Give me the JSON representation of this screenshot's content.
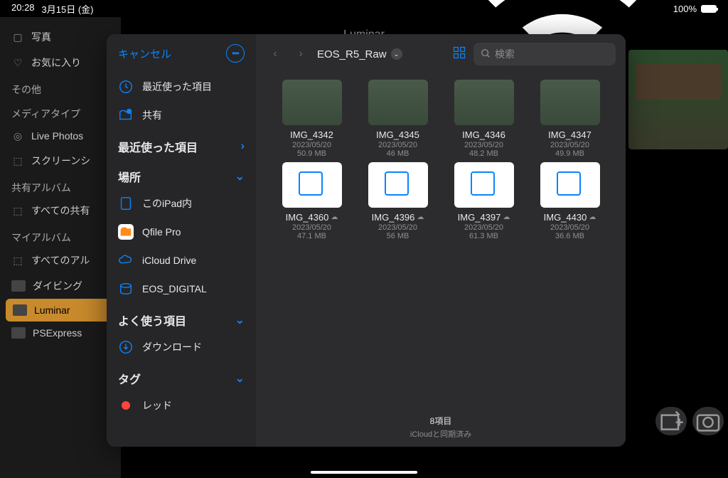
{
  "status": {
    "time": "20:28",
    "date": "3月15日 (金)",
    "battery": "100%"
  },
  "app_title": "Luminar",
  "bg_sidebar": {
    "items": [
      {
        "icon": "photo",
        "label": "写真"
      },
      {
        "icon": "heart",
        "label": "お気に入り"
      }
    ],
    "other_header": "その他",
    "media_header": "メディアタイプ",
    "media": [
      {
        "icon": "live",
        "label": "Live Photos"
      },
      {
        "icon": "screen",
        "label": "スクリーンシ"
      }
    ],
    "shared_header": "共有アルバム",
    "shared": [
      {
        "icon": "shared",
        "label": "すべての共有"
      }
    ],
    "my_header": "マイアルバム",
    "my": [
      {
        "icon": "all",
        "label": "すべてのアル"
      },
      {
        "icon": "thumb",
        "label": "ダイビング"
      },
      {
        "icon": "thumb",
        "label": "Luminar",
        "selected": true
      },
      {
        "icon": "thumb",
        "label": "PSExpress"
      }
    ]
  },
  "picker": {
    "cancel": "キャンセル",
    "side": {
      "recent": "最近使った項目",
      "shared": "共有",
      "recent_header": "最近使った項目",
      "places_header": "場所",
      "places": [
        {
          "icon": "ipad",
          "label": "このiPad内"
        },
        {
          "icon": "qfile",
          "label": "Qfile Pro"
        },
        {
          "icon": "icloud",
          "label": "iCloud Drive"
        },
        {
          "icon": "disk",
          "label": "EOS_DIGITAL"
        }
      ],
      "fav_header": "よく使う項目",
      "fav": [
        {
          "icon": "download",
          "label": "ダウンロード"
        }
      ],
      "tag_header": "タグ",
      "tags": [
        {
          "color": "red",
          "label": "レッド"
        }
      ]
    },
    "path": "EOS_R5_Raw",
    "search_placeholder": "検索",
    "files": [
      {
        "name": "IMG_4342",
        "date": "2023/05/20",
        "size": "50.9 MB",
        "thumb": true
      },
      {
        "name": "IMG_4345",
        "date": "2023/05/20",
        "size": "46 MB",
        "thumb": true
      },
      {
        "name": "IMG_4346",
        "date": "2023/05/20",
        "size": "48.2 MB",
        "thumb": true
      },
      {
        "name": "IMG_4347",
        "date": "2023/05/20",
        "size": "49.9 MB",
        "thumb": true
      },
      {
        "name": "IMG_4360",
        "date": "2023/05/20",
        "size": "47.1 MB",
        "cloud": true
      },
      {
        "name": "IMG_4396",
        "date": "2023/05/20",
        "size": "56 MB",
        "cloud": true
      },
      {
        "name": "IMG_4397",
        "date": "2023/05/20",
        "size": "61.3 MB",
        "cloud": true
      },
      {
        "name": "IMG_4430",
        "date": "2023/05/20",
        "size": "36.6 MB",
        "cloud": true
      }
    ],
    "footer_count": "8項目",
    "footer_sync": "iCloudと同期済み"
  }
}
